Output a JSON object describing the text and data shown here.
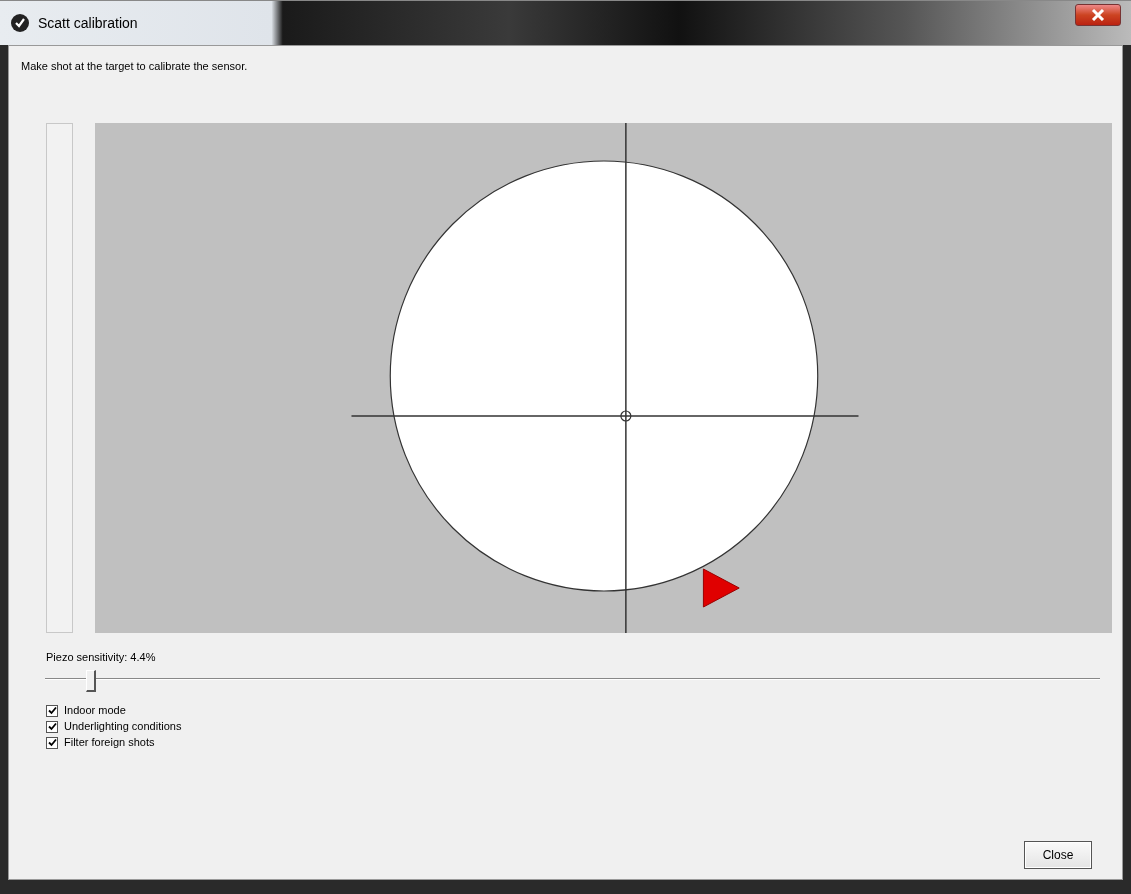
{
  "window": {
    "title": "Scatt calibration"
  },
  "instruction": "Make shot at the target to calibrate the sensor.",
  "sensitivity": {
    "label": "Piezo sensitivity: 4.4%",
    "level": 0.044
  },
  "options": [
    {
      "label": "Indoor mode",
      "checked": true
    },
    {
      "label": "Underlighting conditions",
      "checked": true
    },
    {
      "label": "Filter foreign shots",
      "checked": true
    }
  ],
  "buttons": [
    "Close"
  ]
}
